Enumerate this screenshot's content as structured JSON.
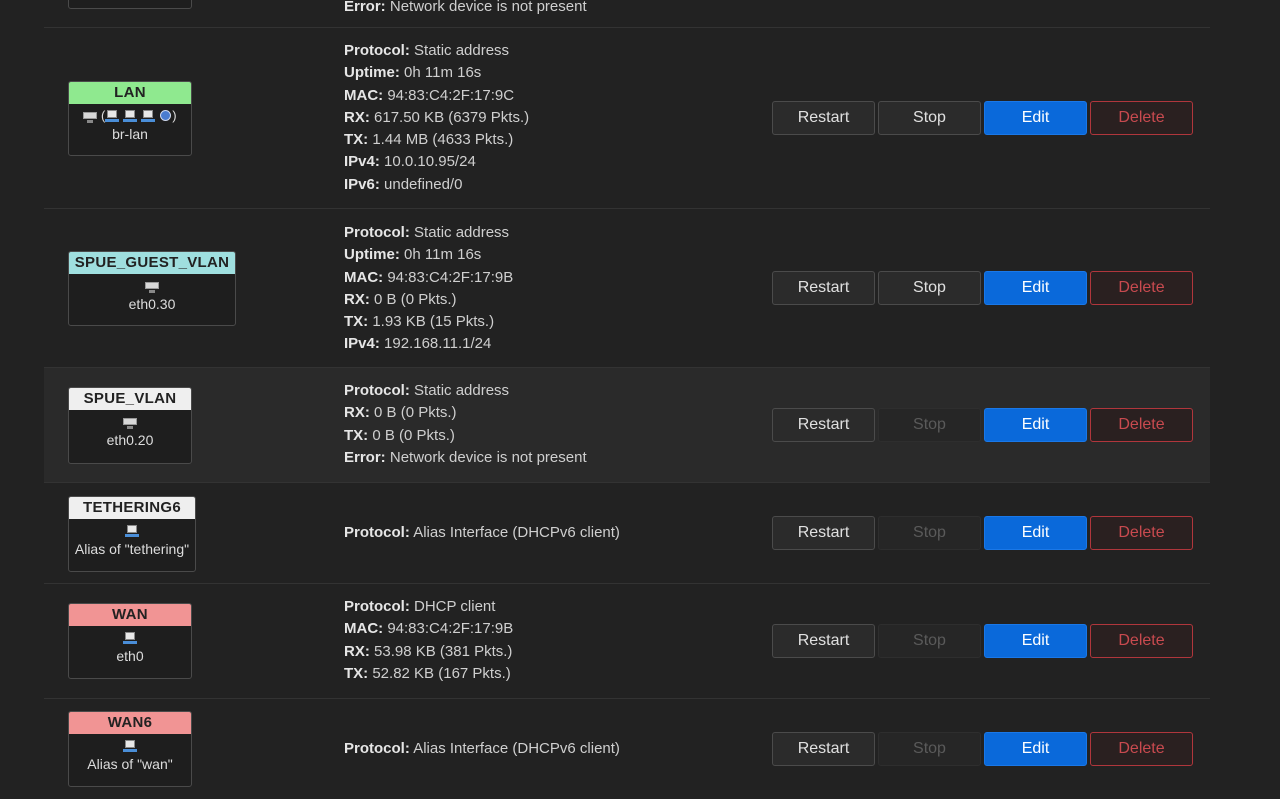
{
  "colors": {
    "lan": "#8fe98f",
    "guest": "#9fdfdf",
    "white": "#efefef",
    "wan": "#f19494"
  },
  "top_fragment": {
    "error_label": "Error:",
    "error_value": "Network device is not present"
  },
  "interfaces": [
    {
      "name": "LAN",
      "device": "br-lan",
      "icons": "bridge-icons",
      "lines": [
        {
          "k": "Protocol:",
          "v": "Static address"
        },
        {
          "k": "Uptime:",
          "v": "0h 11m 16s"
        },
        {
          "k": "MAC:",
          "v": "94:83:C4:2F:17:9C"
        },
        {
          "k": "RX:",
          "v": "617.50 KB (6379 Pkts.)"
        },
        {
          "k": "TX:",
          "v": "1.44 MB (4633 Pkts.)"
        },
        {
          "k": "IPv4:",
          "v": "10.0.10.95/24"
        },
        {
          "k": "IPv6:",
          "v": "undefined/0"
        }
      ],
      "stop_disabled": false
    },
    {
      "name": "SPUE_GUEST_VLAN",
      "device": "eth0.30",
      "icons": "port-icon",
      "lines": [
        {
          "k": "Protocol:",
          "v": "Static address"
        },
        {
          "k": "Uptime:",
          "v": "0h 11m 16s"
        },
        {
          "k": "MAC:",
          "v": "94:83:C4:2F:17:9B"
        },
        {
          "k": "RX:",
          "v": "0 B (0 Pkts.)"
        },
        {
          "k": "TX:",
          "v": "1.93 KB (15 Pkts.)"
        },
        {
          "k": "IPv4:",
          "v": "192.168.11.1/24"
        }
      ],
      "stop_disabled": false
    },
    {
      "name": "SPUE_VLAN",
      "device": "eth0.20",
      "icons": "port-icon",
      "lines": [
        {
          "k": "Protocol:",
          "v": "Static address"
        },
        {
          "k": "RX:",
          "v": "0 B (0 Pkts.)"
        },
        {
          "k": "TX:",
          "v": "0 B (0 Pkts.)"
        },
        {
          "k": "Error:",
          "v": "Network device is not present"
        }
      ],
      "stop_disabled": false
    },
    {
      "name": "TETHERING6",
      "device": "Alias of \"tethering\"",
      "icons": "ethernet-icon",
      "lines": [
        {
          "k": "Protocol:",
          "v": "Alias Interface (DHCPv6 client)"
        }
      ],
      "stop_disabled": true
    },
    {
      "name": "WAN",
      "device": "eth0",
      "icons": "ethernet-icon",
      "lines": [
        {
          "k": "Protocol:",
          "v": "DHCP client"
        },
        {
          "k": "MAC:",
          "v": "94:83:C4:2F:17:9B"
        },
        {
          "k": "RX:",
          "v": "53.98 KB (381 Pkts.)"
        },
        {
          "k": "TX:",
          "v": "52.82 KB (167 Pkts.)"
        }
      ],
      "stop_disabled": true
    },
    {
      "name": "WAN6",
      "device": "Alias of \"wan\"",
      "icons": "ethernet-icon",
      "lines": [
        {
          "k": "Protocol:",
          "v": "Alias Interface (DHCPv6 client)"
        }
      ],
      "stop_disabled": true
    }
  ],
  "buttons": {
    "restart": "Restart",
    "stop": "Stop",
    "edit": "Edit",
    "delete": "Delete"
  }
}
